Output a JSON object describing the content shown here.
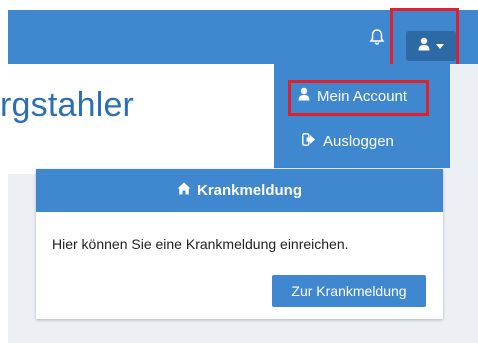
{
  "header": {
    "bell_icon": "bell-icon",
    "user_icon": "user-icon",
    "caret_icon": "caret-down-icon",
    "accent": "#3f88cf",
    "highlight": "#e0202a"
  },
  "page": {
    "title_fragment": "rgstahler"
  },
  "user_menu": {
    "account_label": "Mein Account",
    "logout_label": "Ausloggen"
  },
  "card": {
    "title": "Krankmeldung",
    "home_icon": "home-icon",
    "text": "Hier können Sie eine Krankmeldung einreichen.",
    "button_label": "Zur Krankmeldung"
  }
}
